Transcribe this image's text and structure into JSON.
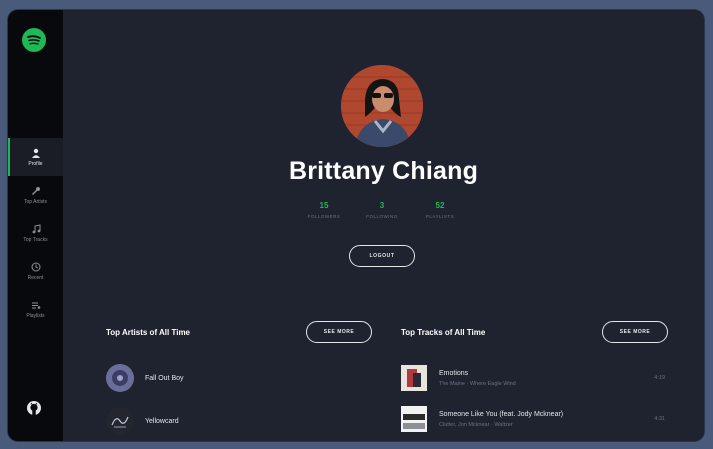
{
  "app": {
    "name": "Spotify Profile"
  },
  "sidebar": {
    "logo_icon": "spotify-logo",
    "items": [
      {
        "label": "Profile",
        "icon": "user-icon",
        "active": true
      },
      {
        "label": "Top Artists",
        "icon": "microphone-icon",
        "active": false
      },
      {
        "label": "Top Tracks",
        "icon": "music-note-icon",
        "active": false
      },
      {
        "label": "Recent",
        "icon": "clock-icon",
        "active": false
      },
      {
        "label": "Playlists",
        "icon": "playlist-icon",
        "active": false
      }
    ],
    "footer_icon": "github-icon"
  },
  "profile": {
    "name": "Brittany Chiang",
    "stats": [
      {
        "value": "15",
        "label": "FOLLOWERS"
      },
      {
        "value": "3",
        "label": "FOLLOWING"
      },
      {
        "value": "52",
        "label": "PLAYLISTS"
      }
    ],
    "logout_label": "LOGOUT"
  },
  "top_artists": {
    "title": "Top Artists of All Time",
    "see_more_label": "SEE MORE",
    "items": [
      {
        "name": "Fall Out Boy"
      },
      {
        "name": "Yellowcard"
      }
    ]
  },
  "top_tracks": {
    "title": "Top Tracks of All Time",
    "see_more_label": "SEE MORE",
    "items": [
      {
        "title": "Emotions",
        "subtitle": "The Maine · Where Eagle Wind",
        "duration": "4:19"
      },
      {
        "title": "Someone Like You (feat. Jody Mcknear)",
        "subtitle": "Clutter, Jon Mcknear · Waltzer",
        "duration": "4:31"
      }
    ]
  },
  "colors": {
    "accent": "#1db954",
    "background": "#1f2330",
    "sidebar": "#07090d",
    "frame": "#4a5a7a"
  }
}
